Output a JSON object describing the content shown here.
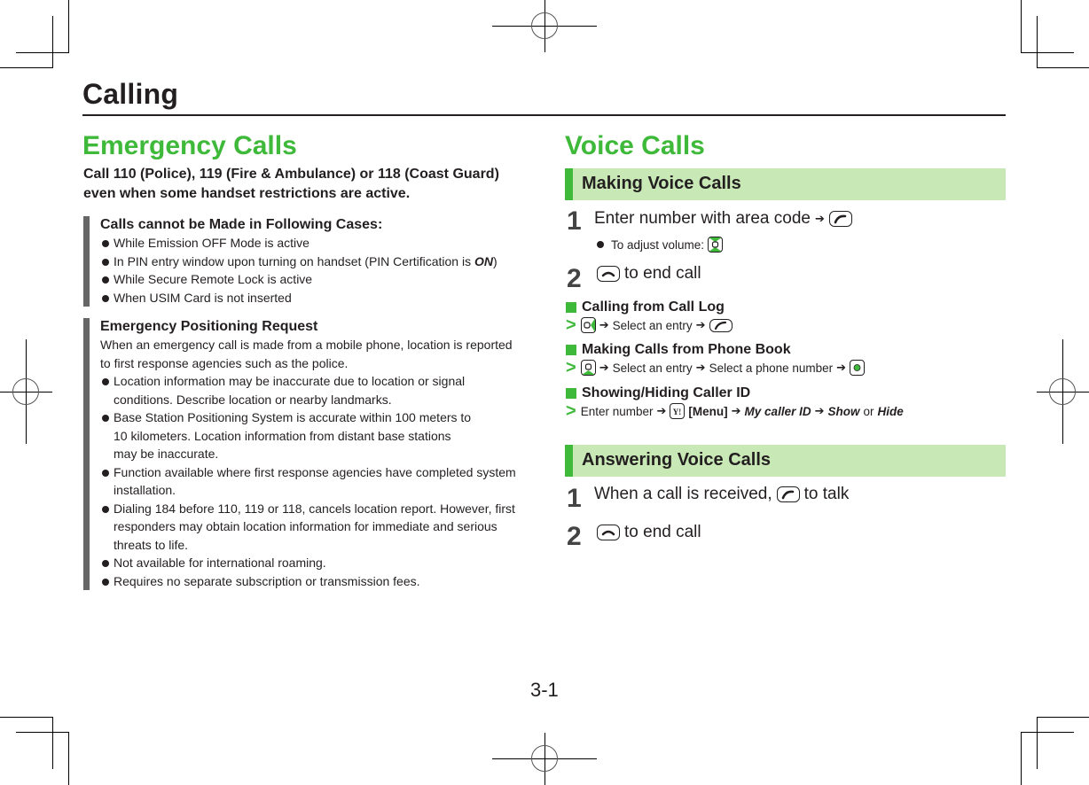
{
  "chapter": {
    "title": "Calling",
    "page_number": "3-1"
  },
  "emergency": {
    "heading": "Emergency Calls",
    "intro_line1": "Call 110 (Police), 119 (Fire & Ambulance) or 118 (Coast Guard)",
    "intro_line2": "even when some handset restrictions are active.",
    "cases_note": {
      "title": "Calls cannot be Made in Following Cases:",
      "items": [
        "While Emission OFF Mode is active",
        "In PIN entry window upon turning on handset (PIN Certification is ",
        "While Secure Remote Lock is active",
        "When USIM Card is not inserted"
      ],
      "pin_on": "ON",
      "pin_close": ")"
    },
    "positioning_note": {
      "title": "Emergency Positioning Request",
      "body": "When an emergency call is made from a mobile phone, location is reported to first response agencies such as the police.",
      "items": [
        "Location information may be inaccurate due to location or signal conditions. Describe location or nearby landmarks.",
        "Base Station Positioning System is accurate within 100 meters to 10 kilometers. Location information from distant base stations may be inaccurate.",
        "Function available where first response agencies have completed system installation.",
        "Dialing 184 before 110, 119 or 118, cancels location report. However, first responders may obtain location information for immediate and serious threats to life.",
        "Not available for international roaming.",
        "Requires no separate subscription or transmission fees."
      ]
    }
  },
  "voice": {
    "heading": "Voice Calls",
    "making": {
      "title": "Making Voice Calls",
      "step1_num": "1",
      "step1_text": "Enter number with area code",
      "step1_sub": "To adjust volume:",
      "step2_num": "2",
      "step2_text": "to end call"
    },
    "call_log": {
      "title": "Calling from Call Log",
      "select": "Select an entry"
    },
    "phone_book": {
      "title": "Making Calls from Phone Book",
      "select": "Select an entry",
      "select_number": "Select a phone number"
    },
    "caller_id": {
      "title": "Showing/Hiding Caller ID",
      "enter": "Enter number",
      "menu": "[Menu]",
      "my_caller_id": "My caller ID",
      "show": "Show",
      "or": "or",
      "hide": "Hide"
    },
    "answering": {
      "title": "Answering Voice Calls",
      "step1_num": "1",
      "step1_pre": "When a call is received,",
      "step1_post": "to talk",
      "step2_num": "2",
      "step2_text": "to end call"
    },
    "arrow": "➔",
    "gt": ">"
  },
  "icons": {
    "start_key": "phone-start-key",
    "end_key": "phone-end-key",
    "volume_key": "nav-up-down-key",
    "call_log_key": "nav-right-key",
    "phone_book_key": "nav-down-key",
    "center_key": "center-key",
    "yahoo_key": "yahoo-menu-key"
  },
  "colors": {
    "accent_green": "#3eb93a",
    "header_band": "#c8e8b6",
    "note_bar": "#666666"
  }
}
